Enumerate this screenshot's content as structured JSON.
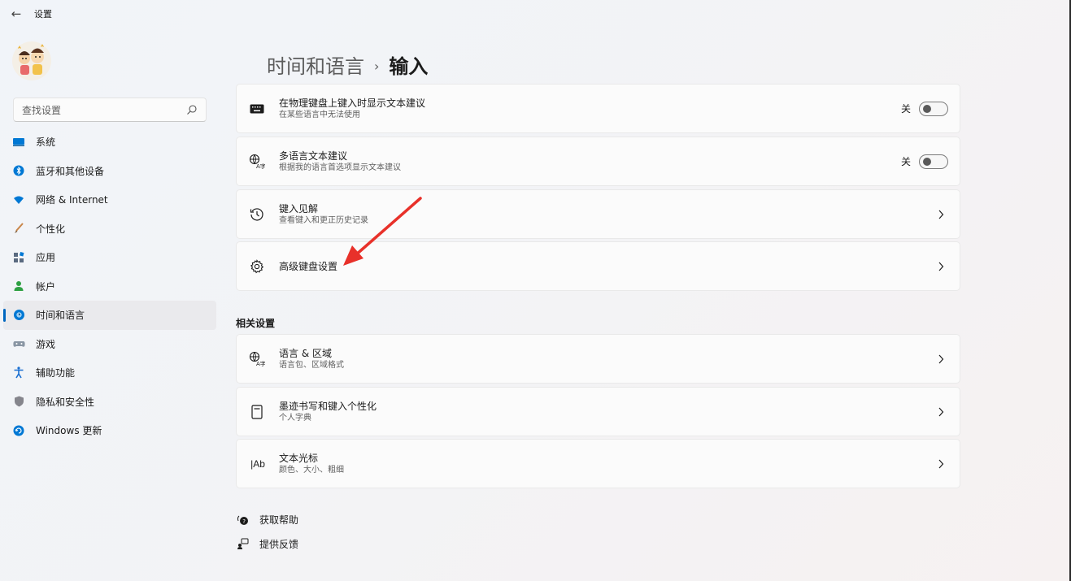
{
  "window": {
    "title": "设置",
    "back_icon": "back-arrow-icon"
  },
  "sidebar": {
    "search_placeholder": "查找设置",
    "items": [
      {
        "label": "系统",
        "icon": "display-icon",
        "color": "#0078d4",
        "selected": false
      },
      {
        "label": "蓝牙和其他设备",
        "icon": "bluetooth-icon",
        "color": "#0078d4",
        "selected": false
      },
      {
        "label": "网络 & Internet",
        "icon": "wifi-icon",
        "color": "#0078d4",
        "selected": false
      },
      {
        "label": "个性化",
        "icon": "brush-icon",
        "color": "#d08040",
        "selected": false
      },
      {
        "label": "应用",
        "icon": "apps-icon",
        "color": "#5a6a80",
        "selected": false
      },
      {
        "label": "帐户",
        "icon": "person-icon",
        "color": "#2ea043",
        "selected": false
      },
      {
        "label": "时间和语言",
        "icon": "globe-clock-icon",
        "color": "#0078d4",
        "selected": true
      },
      {
        "label": "游戏",
        "icon": "gamepad-icon",
        "color": "#7a8694",
        "selected": false
      },
      {
        "label": "辅助功能",
        "icon": "accessibility-icon",
        "color": "#1a6fd1",
        "selected": false
      },
      {
        "label": "隐私和安全性",
        "icon": "shield-icon",
        "color": "#7a7a80",
        "selected": false
      },
      {
        "label": "Windows 更新",
        "icon": "update-icon",
        "color": "#0078d4",
        "selected": false
      }
    ]
  },
  "breadcrumb": {
    "parent": "时间和语言",
    "separator": "›",
    "current": "输入"
  },
  "cards": [
    {
      "title": "在物理键盘上键入时显示文本建议",
      "subtitle": "在某些语言中无法使用",
      "icon": "keyboard-icon",
      "control": "toggle",
      "state_label": "关",
      "checked": false
    },
    {
      "title": "多语言文本建议",
      "subtitle": "根据我的语言首选项显示文本建议",
      "icon": "language-icon",
      "control": "toggle",
      "state_label": "关",
      "checked": false
    },
    {
      "title": "键入见解",
      "subtitle": "查看键入和更正历史记录",
      "icon": "history-icon",
      "control": "chevron"
    },
    {
      "title": "高级键盘设置",
      "subtitle": "",
      "icon": "gear-icon",
      "control": "chevron"
    }
  ],
  "related": {
    "heading": "相关设置",
    "cards": [
      {
        "title": "语言 & 区域",
        "subtitle": "语言包、区域格式",
        "icon": "language-icon",
        "control": "chevron"
      },
      {
        "title": "墨迹书写和键入个性化",
        "subtitle": "个人字典",
        "icon": "notebook-icon",
        "control": "chevron"
      },
      {
        "title": "文本光标",
        "subtitle": "颜色、大小、粗细",
        "icon": "text-cursor-icon",
        "icon_text": "|Ab",
        "control": "chevron"
      }
    ]
  },
  "footer": [
    {
      "label": "获取帮助",
      "icon": "help-icon"
    },
    {
      "label": "提供反馈",
      "icon": "feedback-icon"
    }
  ],
  "annotation": {
    "color": "#e8312a"
  },
  "colors": {
    "accent": "#0067c0",
    "annotation": "#e8312a"
  }
}
